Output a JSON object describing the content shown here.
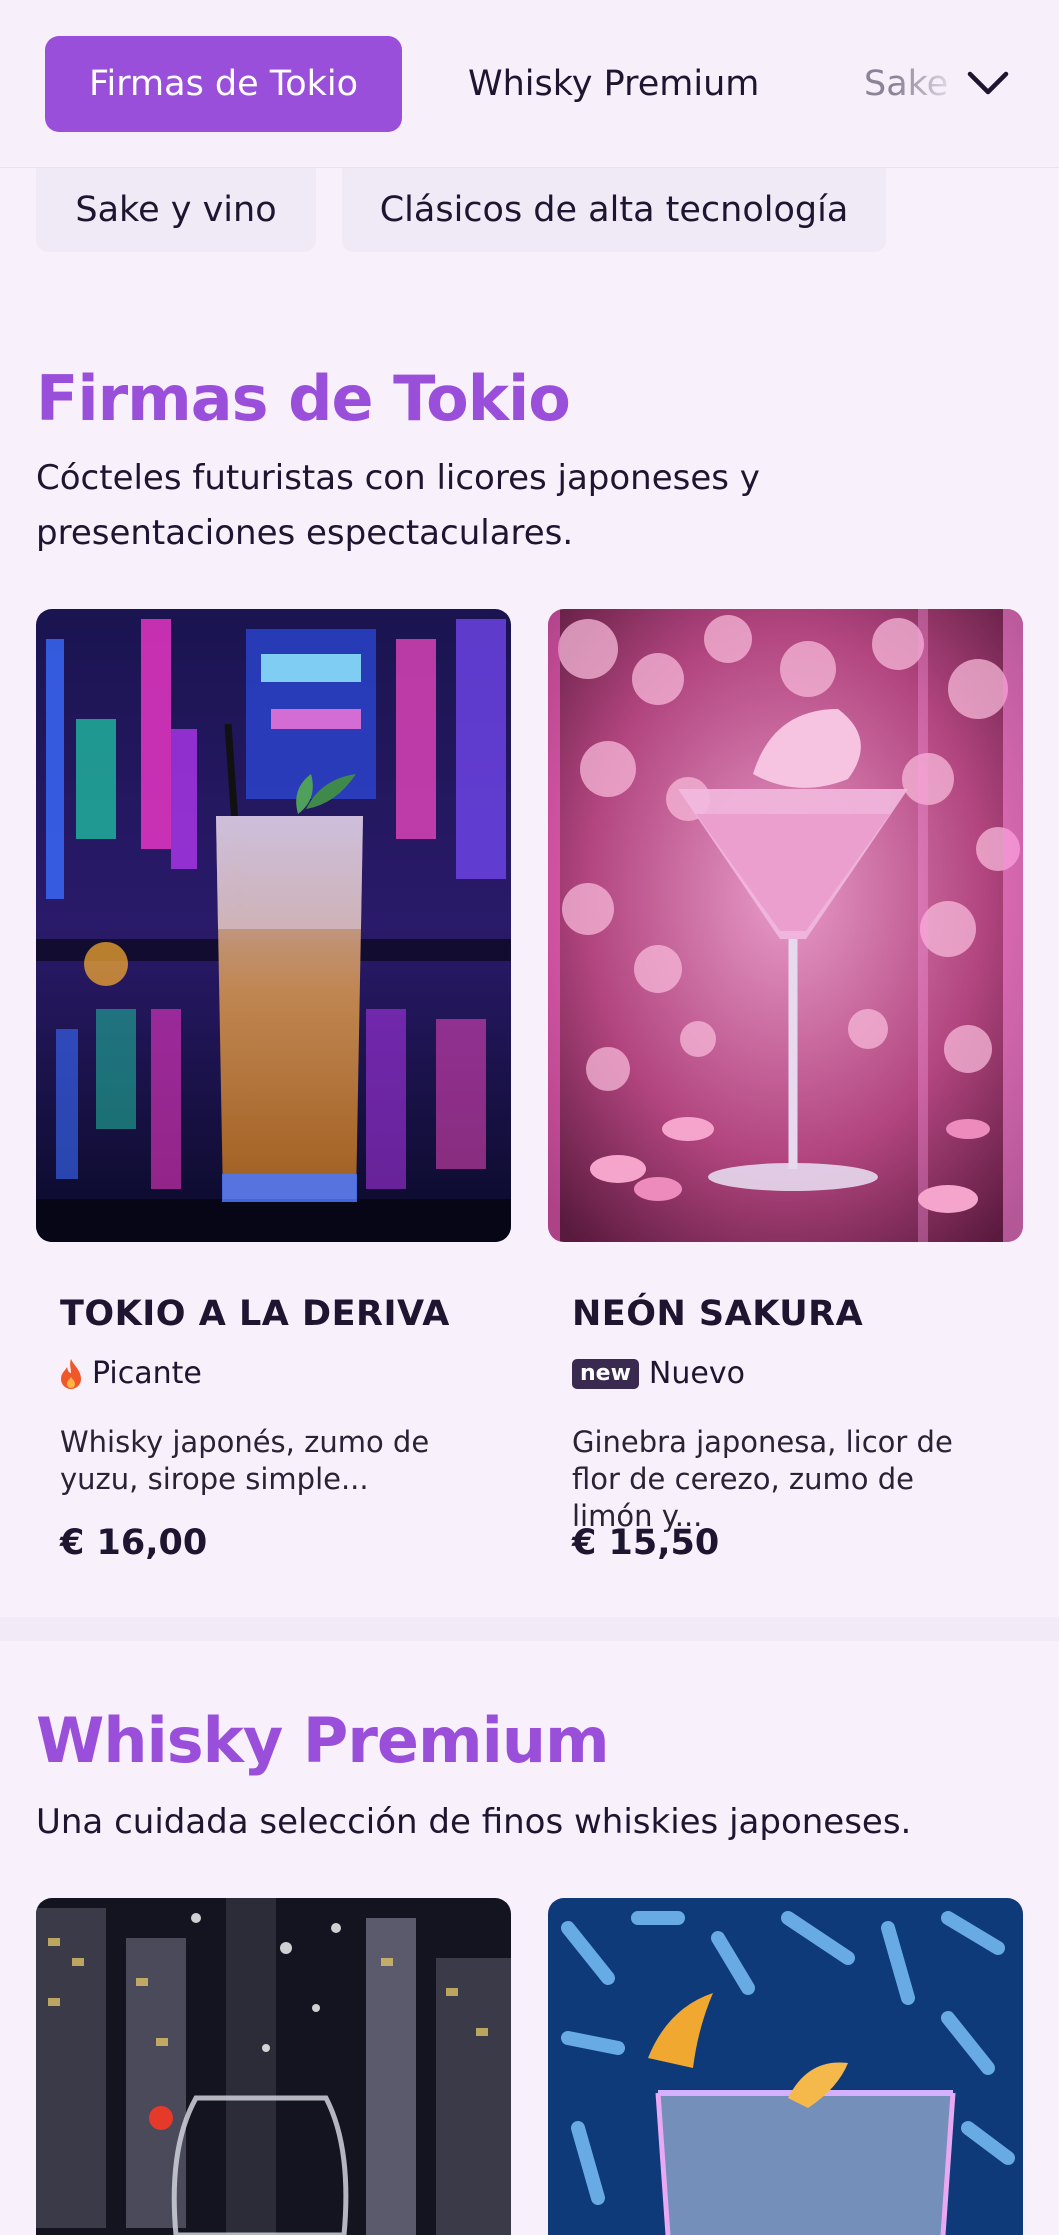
{
  "nav": {
    "tabs": [
      "Firmas de Tokio",
      "Whisky Premium",
      "Sake y vino"
    ],
    "chips": [
      "Sake y vino",
      "Clásicos de alta tecnología"
    ],
    "expand_icon": "chevron-down-icon"
  },
  "sections": [
    {
      "title": "Firmas de Tokio",
      "description": "Cócteles futuristas con licores japoneses y presentaciones espectaculares.",
      "items": [
        {
          "name": "TOKIO A LA DERIVA",
          "tag_icon": "flame-icon",
          "tag": "Picante",
          "description": "Whisky japonés, zumo de yuzu, sirope simple...",
          "price": "€ 16,00"
        },
        {
          "name": "NEÓN SAKURA",
          "tag_badge": "new",
          "tag": "Nuevo",
          "description": "Ginebra japonesa, licor de flor de cerezo, zumo de limón y...",
          "price": "€ 15,50"
        }
      ]
    },
    {
      "title": "Whisky Premium",
      "description": "Una cuidada selección de finos whiskies japoneses."
    }
  ],
  "colors": {
    "accent": "#9a4fdb",
    "background": "#f8f0fb",
    "text": "#1e1530",
    "flame": "#f0582a"
  }
}
